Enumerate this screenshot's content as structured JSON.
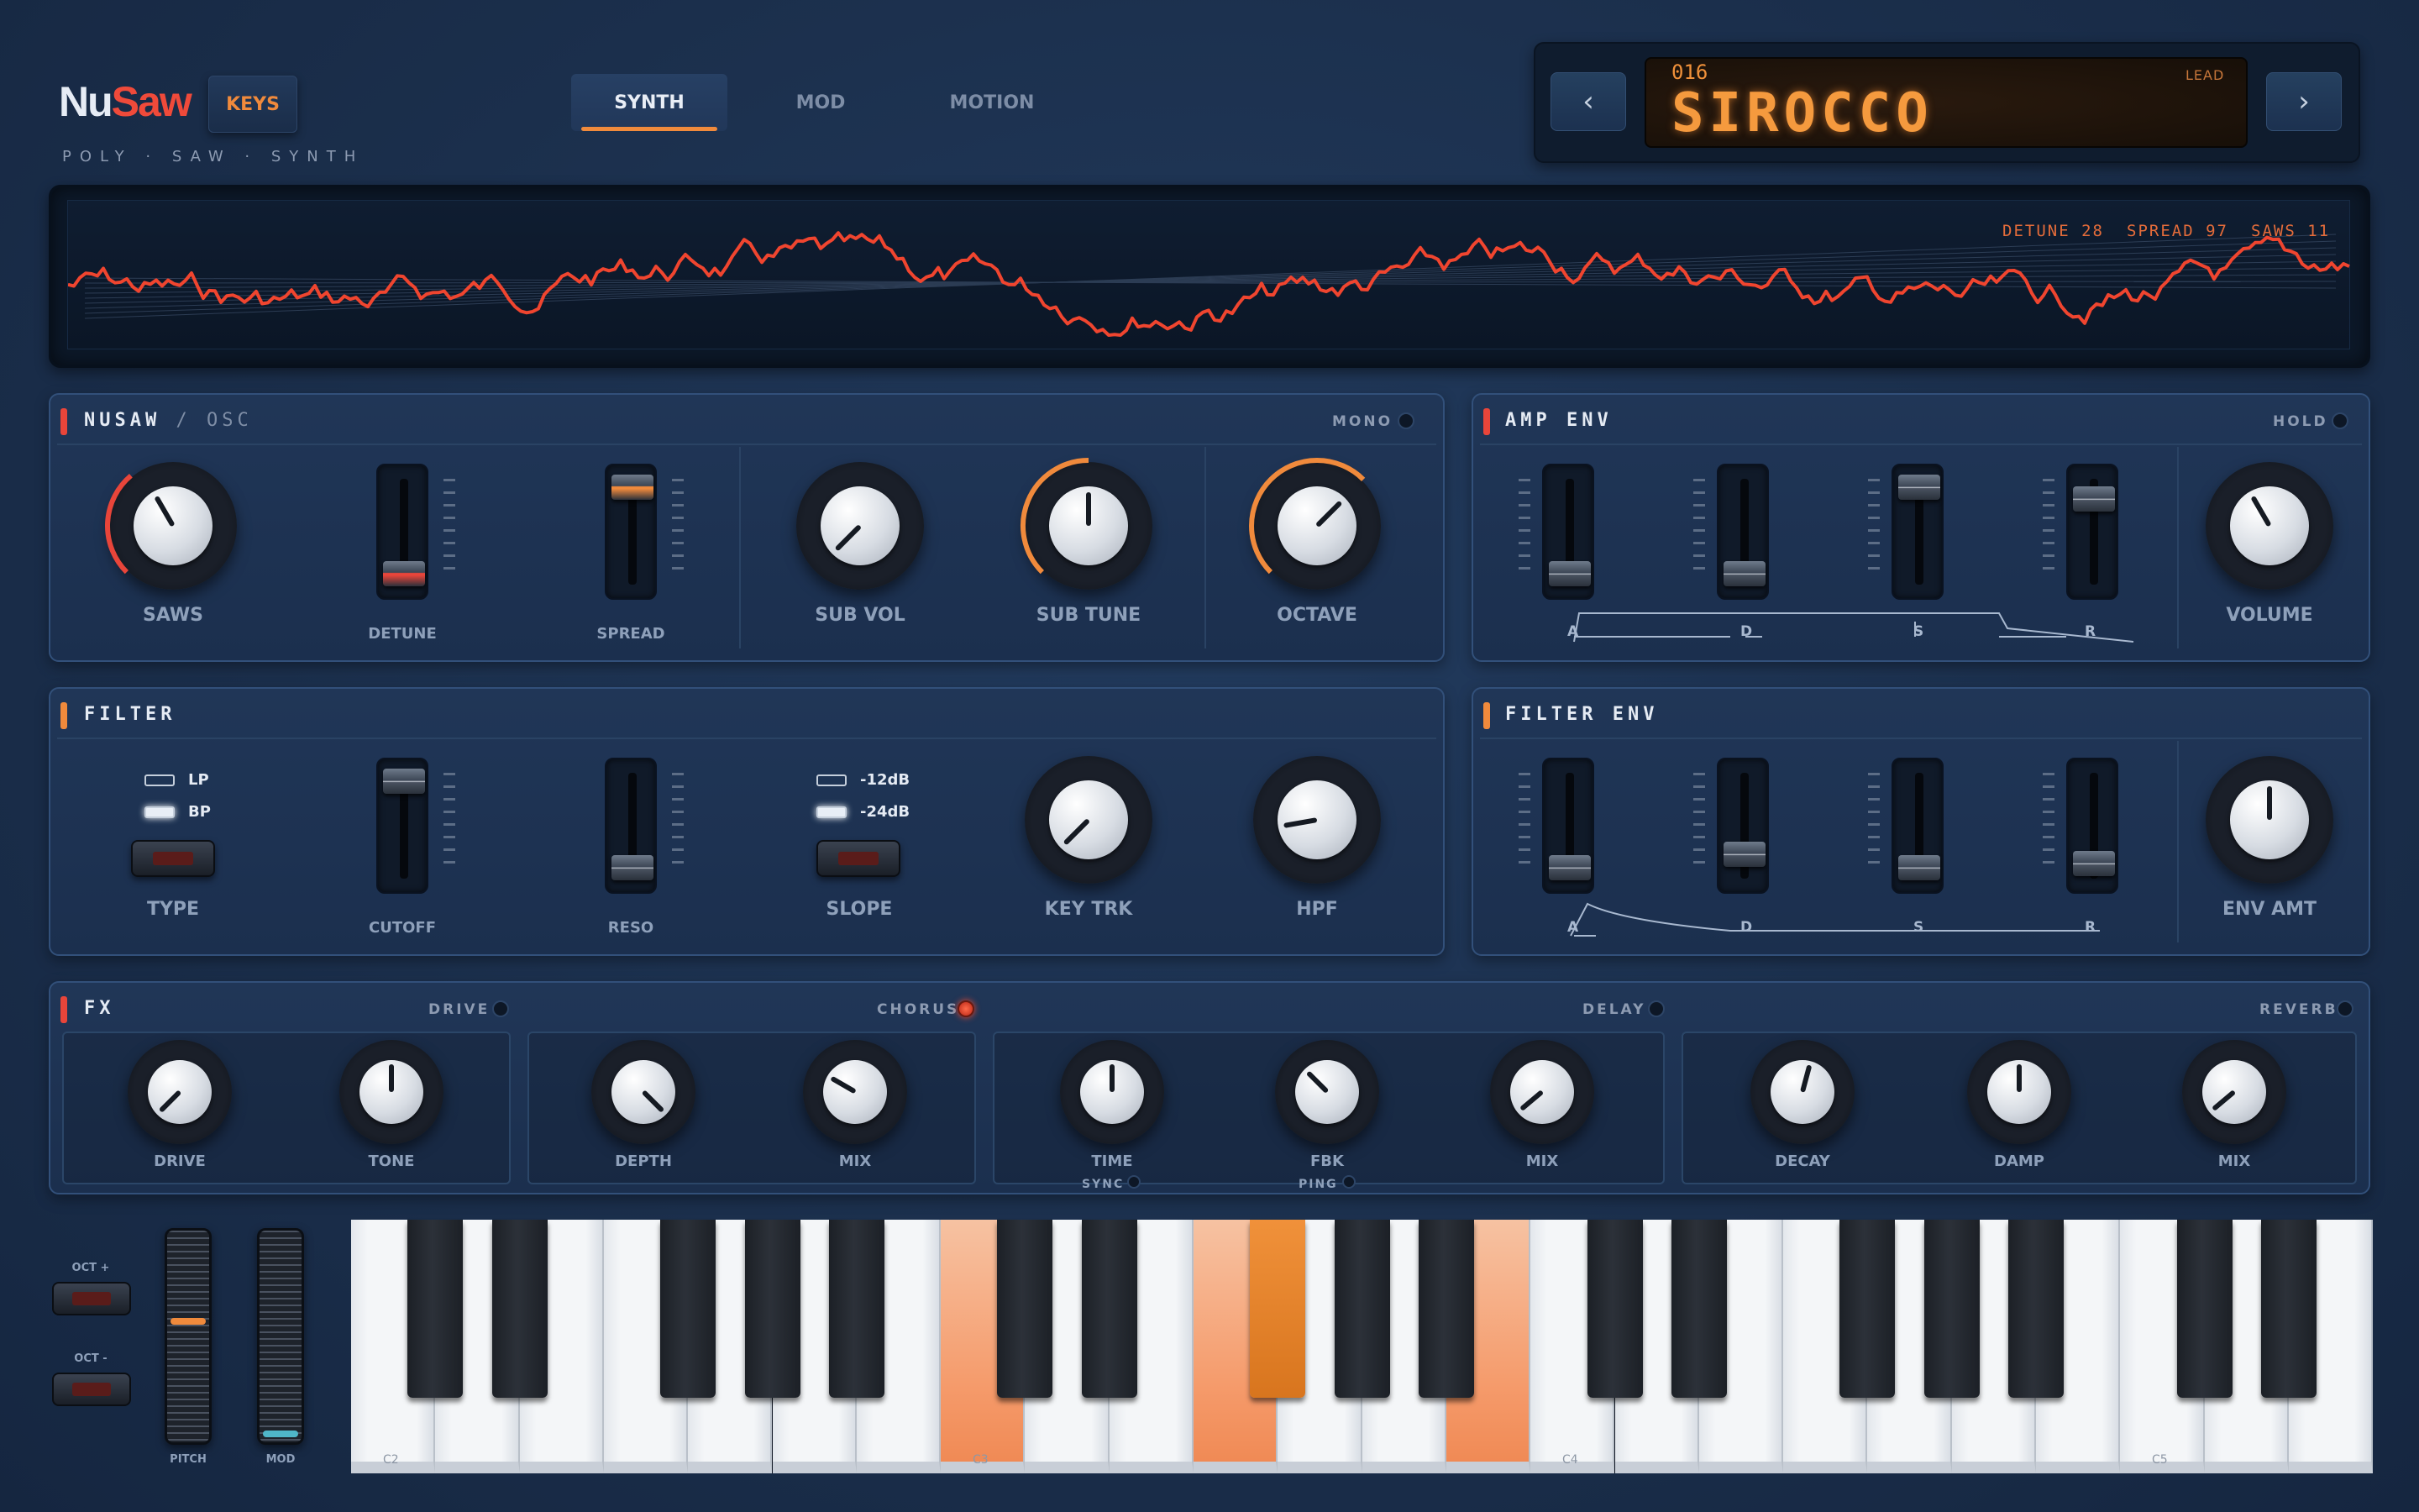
{
  "header": {
    "logo_nu": "Nu",
    "logo_saw": "Saw",
    "tagline": "POLY · SAW · SYNTH",
    "keys_button": "KEYS",
    "tabs": [
      {
        "label": "SYNTH",
        "active": true
      },
      {
        "label": "MOD",
        "active": false
      },
      {
        "label": "MOTION",
        "active": false
      }
    ]
  },
  "preset": {
    "number": "016",
    "name": "SIROCCO",
    "category": "LEAD",
    "prev_icon": "chevron-left",
    "next_icon": "chevron-right",
    "prev_glyph": "‹",
    "next_glyph": "›"
  },
  "scope": {
    "detune": "DETUNE 28",
    "spread": "SPREAD 97",
    "saws": "SAWS 11",
    "trace_color": "#f0452f"
  },
  "osc": {
    "title": "NUSAW",
    "subtitle": "/ OSC",
    "mono_label": "MONO",
    "mono_on": false,
    "saws_label": "SAWS",
    "saws_value": 11,
    "detune_label": "DETUNE",
    "detune_value": 0.28,
    "spread_label": "SPREAD",
    "spread_value": 0.97,
    "subvol_label": "SUB VOL",
    "subtune_label": "SUB TUNE",
    "octave_label": "OCTAVE"
  },
  "amp_env": {
    "title": "AMP ENV",
    "hold_label": "HOLD",
    "hold_on": false,
    "stage_labels": [
      "A",
      "D",
      "S",
      "R"
    ],
    "volume_label": "VOLUME"
  },
  "filter": {
    "title": "FILTER",
    "type_options": [
      "LP",
      "BP"
    ],
    "type_selected": "BP",
    "type_label": "TYPE",
    "cutoff_label": "CUTOFF",
    "reso_label": "RESO",
    "slope_options": [
      "-12dB",
      "-24dB"
    ],
    "slope_selected": "-24dB",
    "slope_label": "SLOPE",
    "keytrk_label": "KEY TRK",
    "hpf_label": "HPF"
  },
  "filter_env": {
    "title": "FILTER ENV",
    "stage_labels": [
      "A",
      "D",
      "S",
      "R"
    ],
    "envamt_label": "ENV AMT"
  },
  "fx": {
    "title": "FX",
    "drive": {
      "label": "DRIVE",
      "on": false,
      "knobs": [
        "DRIVE",
        "TONE"
      ]
    },
    "chorus": {
      "label": "CHORUS",
      "on": true,
      "knobs": [
        "DEPTH",
        "MIX"
      ]
    },
    "delay": {
      "label": "DELAY",
      "on": false,
      "knobs": [
        "TIME",
        "FBK",
        "MIX"
      ],
      "sync_label": "SYNC",
      "ping_label": "PING"
    },
    "reverb": {
      "label": "REVERB",
      "on": false,
      "knobs": [
        "DECAY",
        "DAMP",
        "MIX"
      ]
    }
  },
  "keyboard": {
    "oct_up": "OCT +",
    "oct_down": "OCT -",
    "pitch_label": "PITCH",
    "mod_label": "MOD",
    "note_labels": [
      "C2",
      "C3",
      "C4",
      "C5"
    ],
    "pressed_color": "#f59a6a",
    "pitch_color": "#f08a3c",
    "mod_color": "#4fb6c8"
  },
  "colors": {
    "accent": "#f08a3c",
    "brand_red": "#ef4a3a",
    "panel_bg": "#1f3556"
  }
}
